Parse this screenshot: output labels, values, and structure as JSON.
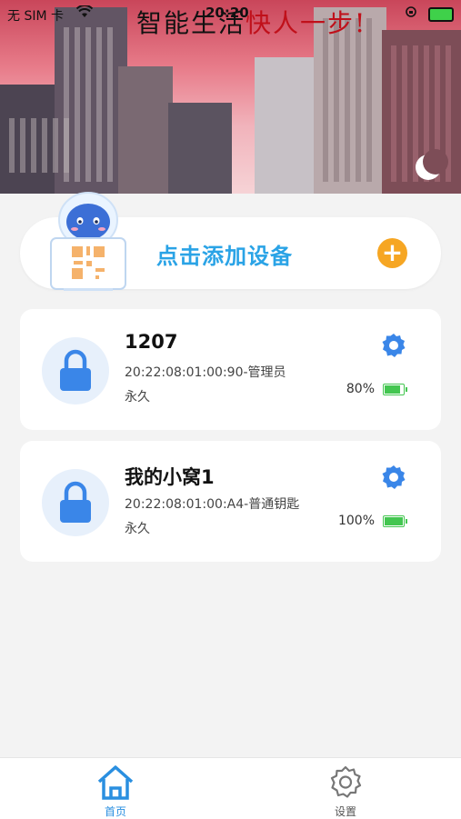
{
  "status_bar": {
    "carrier": "无 SIM 卡",
    "time": "20:20"
  },
  "banner": {
    "slogan_part1": "智能生活",
    "slogan_part2": "快人一步!"
  },
  "add_device": {
    "label": "点击添加设备"
  },
  "devices": [
    {
      "name": "1207",
      "address": "20:22:08:01:00:90-管理员",
      "validity": "永久",
      "battery": "80%",
      "battery_level": 80
    },
    {
      "name": "我的小窝1",
      "address": "20:22:08:01:00:A4-普通钥匙",
      "validity": "永久",
      "battery": "100%",
      "battery_level": 100
    }
  ],
  "tabs": [
    {
      "label": "首页",
      "icon": "home-icon",
      "active": true
    },
    {
      "label": "设置",
      "icon": "gear-icon",
      "active": false
    }
  ],
  "colors": {
    "accent": "#2aa3e6",
    "add_button": "#f6a623",
    "lock": "#3a86e8",
    "battery": "#43c650"
  }
}
